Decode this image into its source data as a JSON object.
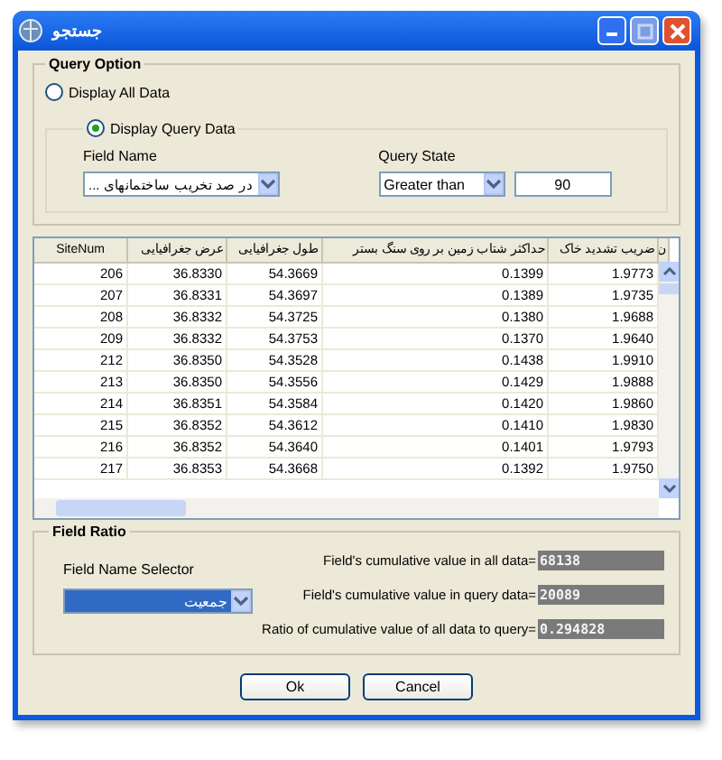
{
  "window": {
    "title": "جستجو"
  },
  "query_option": {
    "title": "Query Option",
    "radios": [
      {
        "label": "Display All Data",
        "selected": false
      },
      {
        "label": "Display Query Data",
        "selected": true
      }
    ],
    "field_name": {
      "label": "Field Name",
      "value": "در صد تخریب ساختمانهای ..."
    },
    "query_state": {
      "label": "Query State",
      "value": "Greater than"
    },
    "query_value": "90"
  },
  "table": {
    "columns": [
      "SiteNum",
      "عرض جغرافیایی",
      "طول جغرافیایی",
      "حداکثر شتاب زمین بر روی سنگ بستر",
      "ضریب تشدید خاک",
      "ن"
    ],
    "rows": [
      [
        "206",
        "36.8330",
        "54.3669",
        "0.1399",
        "1.9773"
      ],
      [
        "207",
        "36.8331",
        "54.3697",
        "0.1389",
        "1.9735"
      ],
      [
        "208",
        "36.8332",
        "54.3725",
        "0.1380",
        "1.9688"
      ],
      [
        "209",
        "36.8332",
        "54.3753",
        "0.1370",
        "1.9640"
      ],
      [
        "212",
        "36.8350",
        "54.3528",
        "0.1438",
        "1.9910"
      ],
      [
        "213",
        "36.8350",
        "54.3556",
        "0.1429",
        "1.9888"
      ],
      [
        "214",
        "36.8351",
        "54.3584",
        "0.1420",
        "1.9860"
      ],
      [
        "215",
        "36.8352",
        "54.3612",
        "0.1410",
        "1.9830"
      ],
      [
        "216",
        "36.8352",
        "54.3640",
        "0.1401",
        "1.9793"
      ],
      [
        "217",
        "36.8353",
        "54.3668",
        "0.1392",
        "1.9750"
      ]
    ]
  },
  "field_ratio": {
    "title": "Field Ratio",
    "selector_label": "Field Name Selector",
    "selector_value": "جمعیت",
    "results": [
      {
        "label": "Field's cumulative value in all data=",
        "value": "68138"
      },
      {
        "label": "Field's cumulative value in query data=",
        "value": "20089"
      },
      {
        "label": "Ratio of cumulative value of all data to query=",
        "value": "0.294828"
      }
    ]
  },
  "buttons": [
    "Ok",
    "Cancel"
  ]
}
